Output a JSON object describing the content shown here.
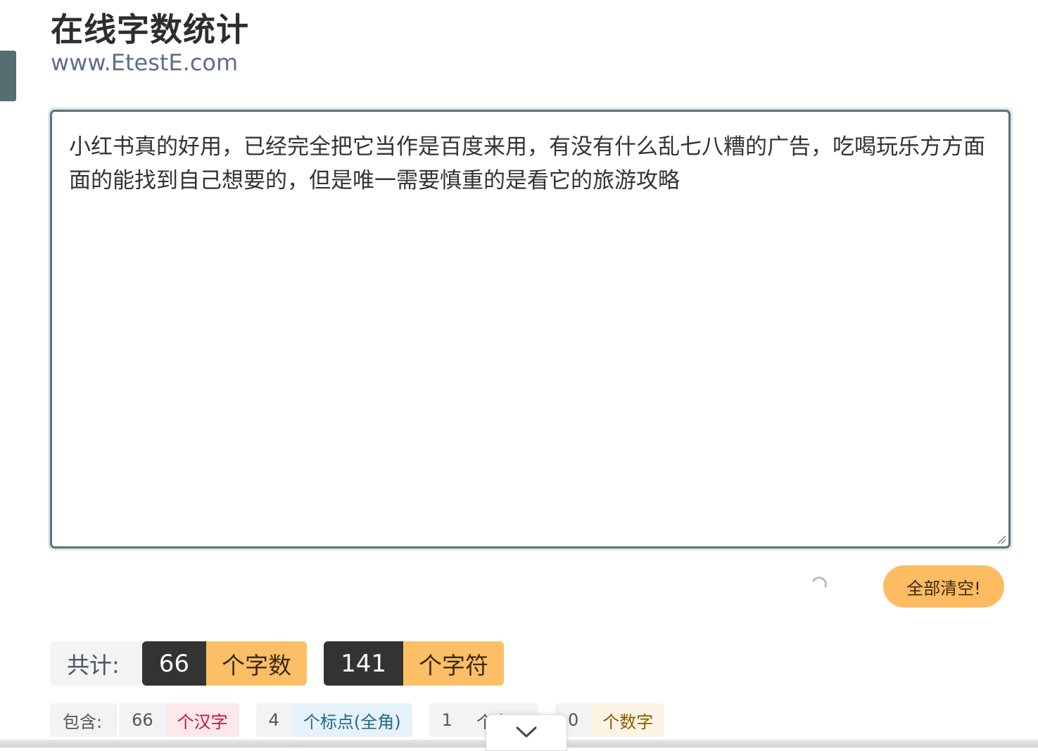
{
  "header": {
    "title": "在线字数统计",
    "subtitle": "www.EtestE.com"
  },
  "editor": {
    "text": "小红书真的好用，已经完全把它当作是百度来用，有没有什么乱七八糟的广告，吃喝玩乐方方面面的能找到自己想要的，但是唯一需要慎重的是看它的旅游攻略"
  },
  "actions": {
    "clear_label": "全部清空!"
  },
  "totals": {
    "label": "共计:",
    "words_count": "66",
    "words_unit": "个字数",
    "chars_count": "141",
    "chars_unit": "个字符"
  },
  "details": {
    "label": "包含:",
    "items": [
      {
        "count": "66",
        "unit": "个汉字"
      },
      {
        "count": "4",
        "unit": "个标点(全角)"
      },
      {
        "count": "1",
        "unit": "个字母"
      },
      {
        "count": "0",
        "unit": "个数字"
      }
    ]
  },
  "colors": {
    "accent": "#fdbb62",
    "dark": "#333333",
    "border": "#58727a"
  }
}
